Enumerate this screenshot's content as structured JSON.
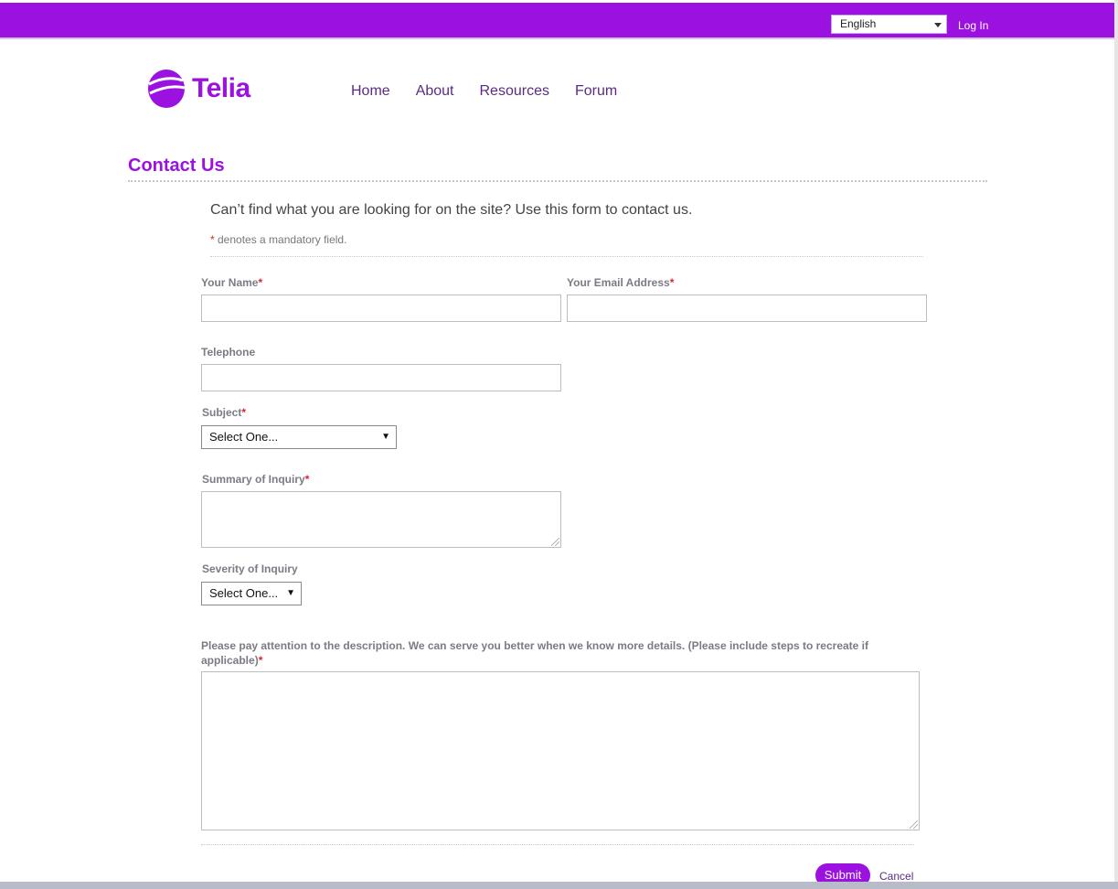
{
  "header": {
    "language": "English",
    "login_label": "Log In"
  },
  "brand": {
    "name": "Telia",
    "color": "#9b11e0"
  },
  "nav": {
    "items": [
      "Home",
      "About",
      "Resources",
      "Forum"
    ]
  },
  "page": {
    "title": "Contact Us",
    "intro": "Can’t find what you are looking for on the site? Use this form to contact us.",
    "mandatory_star": "*",
    "mandatory_note": " denotes a mandatory field."
  },
  "form": {
    "name_label": "Your Name",
    "email_label": "Your Email Address",
    "telephone_label": "Telephone",
    "subject_label": "Subject",
    "subject_value": "Select One...",
    "summary_label": "Summary of Inquiry",
    "severity_label": "Severity of Inquiry",
    "severity_value": "Select One...",
    "description_label": "Please pay attention to the description. We can serve you better when we know more details. (Please include steps to recreate if applicable)",
    "required_marker": "*",
    "submit_label": "Submit",
    "cancel_label": "Cancel"
  }
}
